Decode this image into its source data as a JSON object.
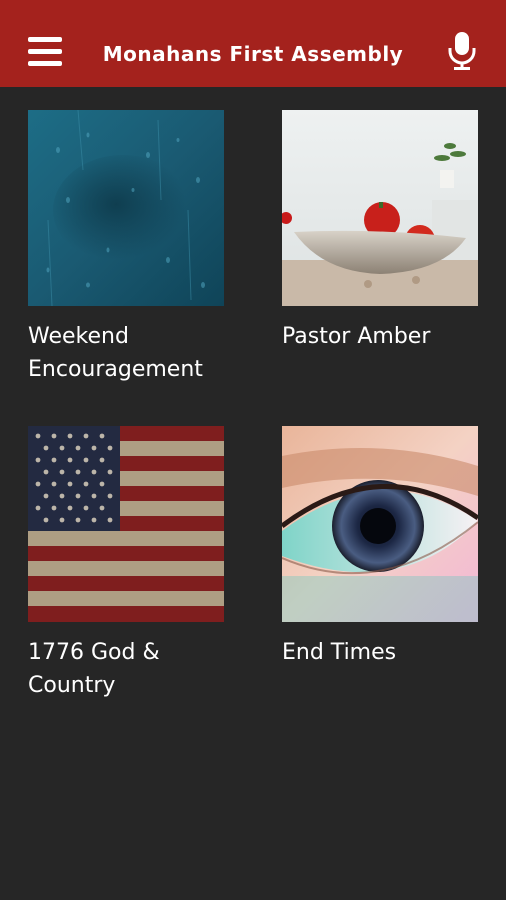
{
  "header": {
    "title": "Monahans First Assembly",
    "menu_icon": "hamburger-menu-icon",
    "mic_icon": "microphone-icon",
    "bar_color": "#a4221d"
  },
  "tiles": [
    {
      "label": "Weekend Encouragement",
      "image": "rain-on-glass"
    },
    {
      "label": "Pastor Amber",
      "image": "fruit-bowl"
    },
    {
      "label": "1776 God & Country",
      "image": "american-flag"
    },
    {
      "label": "End Times",
      "image": "eye-closeup"
    }
  ],
  "background_color": "#262626"
}
